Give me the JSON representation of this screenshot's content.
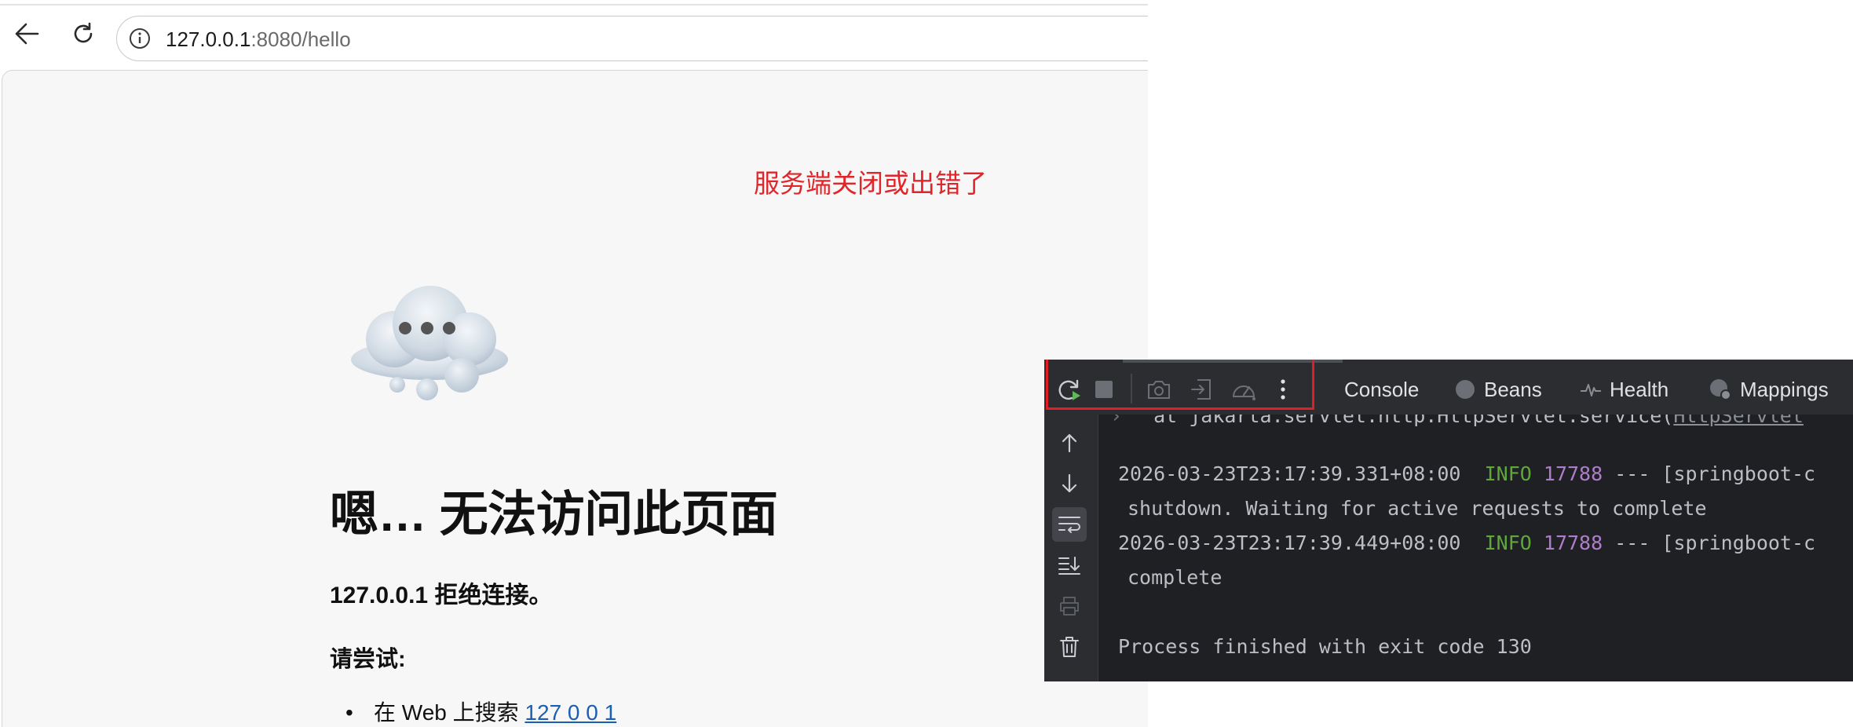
{
  "browser": {
    "url_host": "127.0.0.1",
    "url_rest": ":8080/hello",
    "nav": {
      "back_icon": "arrow-left-icon",
      "reload_icon": "reload-icon",
      "info_icon": "info-circle-icon"
    }
  },
  "page": {
    "annotation": "服务端关闭或出错了",
    "error_title": "嗯… 无法访问此页面",
    "error_subtitle": "127.0.0.1 拒绝连接。",
    "try_label": "请尝试:",
    "suggestion_prefix": "在 Web 上搜索",
    "suggestion_link": "127 0 0 1"
  },
  "ide": {
    "toolbar_icons": [
      "rerun-icon",
      "stop-icon",
      "camera-icon",
      "exit-icon",
      "gauge-icon",
      "more-vertical-icon"
    ],
    "tabs": [
      {
        "label": "Console",
        "icon": ""
      },
      {
        "label": "Beans",
        "icon": "bean-icon"
      },
      {
        "label": "Health",
        "icon": "pulse-icon"
      },
      {
        "label": "Mappings",
        "icon": "mappings-icon"
      }
    ],
    "side_icons": [
      "arrow-up-icon",
      "arrow-down-icon",
      "soft-wrap-icon",
      "scroll-to-end-icon",
      "print-icon",
      "trash-icon"
    ],
    "console": {
      "cut_line": "at jakarta.servlet.http.HttpServlet.service(",
      "cut_line_link": "HttpServlet",
      "line1_ts": "2026-03-23T23:17:39.331+08:00",
      "line1_level": "INFO",
      "line1_pid": "17788",
      "line1_rest": "--- [springboot-c",
      "line2": "shutdown. Waiting for active requests to complete",
      "line3_ts": "2026-03-23T23:17:39.449+08:00",
      "line3_level": "INFO",
      "line3_pid": "17788",
      "line3_rest": "--- [springboot-c",
      "line4": "complete",
      "exit_line": "Process finished with exit code 130"
    }
  },
  "colors": {
    "annotation": "#e0252b",
    "info_level": "#5fa73b",
    "pid": "#b07ccc",
    "link": "#1a5fb4"
  }
}
